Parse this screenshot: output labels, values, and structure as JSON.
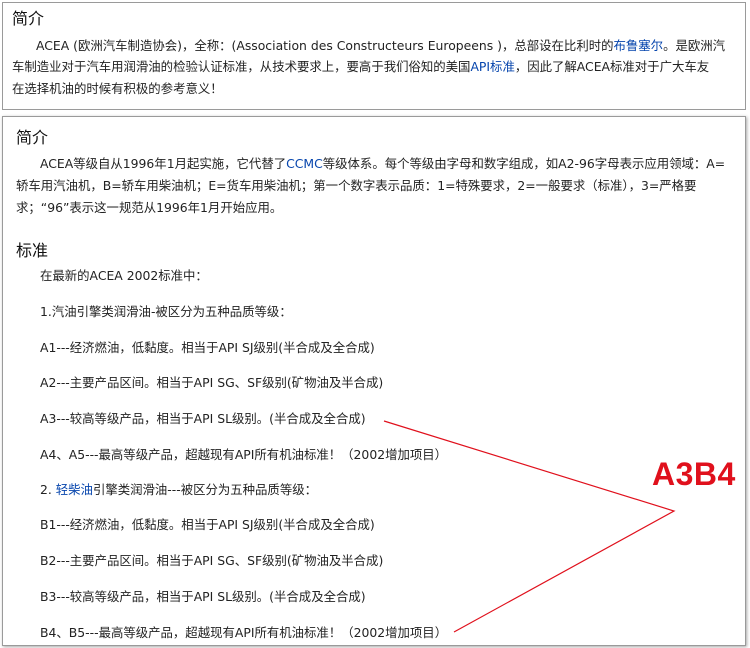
{
  "intro_section": {
    "title": "简介",
    "paragraph": {
      "line1_a": "ACEA (欧洲汽车制造协会)，全称：(Association des Constructeurs Europeens )，总部设在比利时的",
      "line1_link": "布鲁塞尔",
      "line1_b": "。是欧洲汽",
      "line2_a": "车制造业对于汽车用润滑油的检验认证标准，从技术要求上，要高于我们俗知的美国",
      "line2_link": "API标准",
      "line2_b": "，因此了解ACEA标准对于广大车友",
      "line3": "在选择机油的时候有积极的参考意义！"
    }
  },
  "main_section": {
    "title": "简介",
    "paragraph": {
      "line1_a": "ACEA等级自从1996年1月起实施，它代替了",
      "line1_link": "CCMC",
      "line1_b": "等级体系。每个等级由字母和数字组成，如A2-96字母表示应用领域：A=",
      "line2": "轿车用汽油机，B=轿车用柴油机；E=货车用柴油机；第一个数字表示品质：1=特殊要求，2=一般要求（标准），3=严格要",
      "line3": "求；“96”表示这一规范从1996年1月开始应用。"
    },
    "standards_title": "标准",
    "standards": {
      "intro": "在最新的ACEA 2002标准中：",
      "gasoline_heading": "1.汽油引擎类润滑油-被区分为五种品质等级：",
      "a1": "A1---经济燃油，低黏度。相当于API SJ级别(半合成及全合成)",
      "a2": "A2---主要产品区间。相当于API SG、SF级别(矿物油及半合成)",
      "a3": "A3---较高等级产品，相当于API SL级别。(半合成及全合成)",
      "a4a5": "A4、A5---最高等级产品，超越现有API所有机油标准！（2002增加项目）",
      "diesel_heading_a": "2. ",
      "diesel_heading_link": "轻柴油",
      "diesel_heading_b": "引擎类润滑油---被区分为五种品质等级：",
      "b1": "B1---经济燃油，低黏度。相当于API SJ级别(半合成及全合成)",
      "b2": "B2---主要产品区间。相当于API SG、SF级别(矿物油及半合成)",
      "b3": "B3---较高等级产品，相当于API SL级别。(半合成及全合成)",
      "b4b5": "B4、B5---最高等级产品，超越现有API所有机油标准！（2002增加项目）"
    }
  },
  "annotation": {
    "label": "A3B4",
    "color": "#e0101c"
  },
  "colors": {
    "link": "#0645ad",
    "border": "#9a9a9a",
    "annotation": "#e0101c"
  }
}
